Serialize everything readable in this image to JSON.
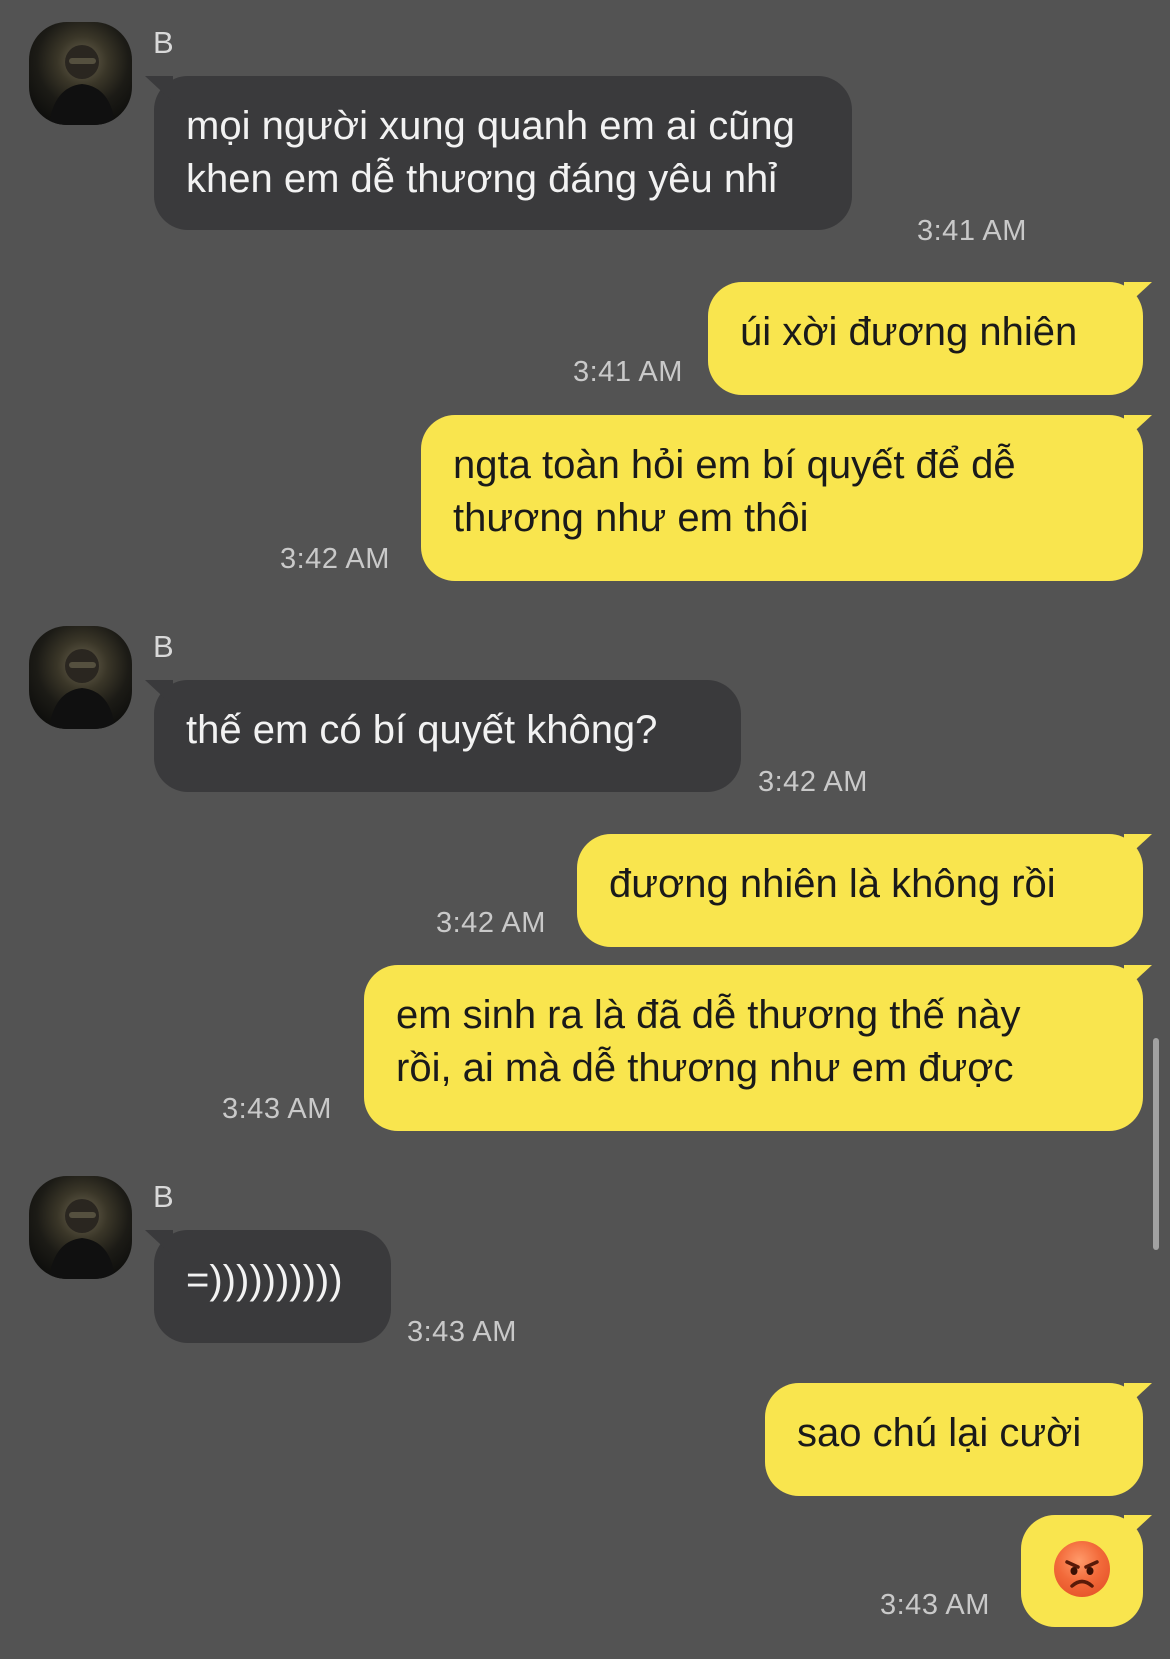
{
  "messages": [
    {
      "sender": "B",
      "text_lines": [
        "mọi người xung quanh em ai cũng",
        "khen em dễ thương đáng yêu nhỉ"
      ],
      "time": "3:41 AM"
    },
    {
      "text": "úi xời đương nhiên",
      "time": "3:41 AM"
    },
    {
      "text_lines": [
        "ngta toàn hỏi em bí quyết để dễ",
        "thương như em thôi"
      ],
      "time": "3:42 AM"
    },
    {
      "sender": "B",
      "text": "thế em có bí quyết không?",
      "time": "3:42 AM"
    },
    {
      "text": "đương nhiên là không rồi",
      "time": "3:42 AM"
    },
    {
      "text_lines": [
        "em sinh ra là đã dễ thương thế này",
        "rồi, ai mà dễ thương như em được"
      ],
      "time": "3:43 AM"
    },
    {
      "sender": "B",
      "text": "=))))))))))",
      "time": "3:43 AM"
    },
    {
      "text": "sao chú lại cười",
      "time": "3:43 AM"
    },
    {
      "emoji": "angry-face",
      "time": "3:43 AM"
    }
  ],
  "colors": {
    "background": "#535353",
    "incoming_bubble": "#3a3a3c",
    "outgoing_bubble": "#f9e54e"
  }
}
